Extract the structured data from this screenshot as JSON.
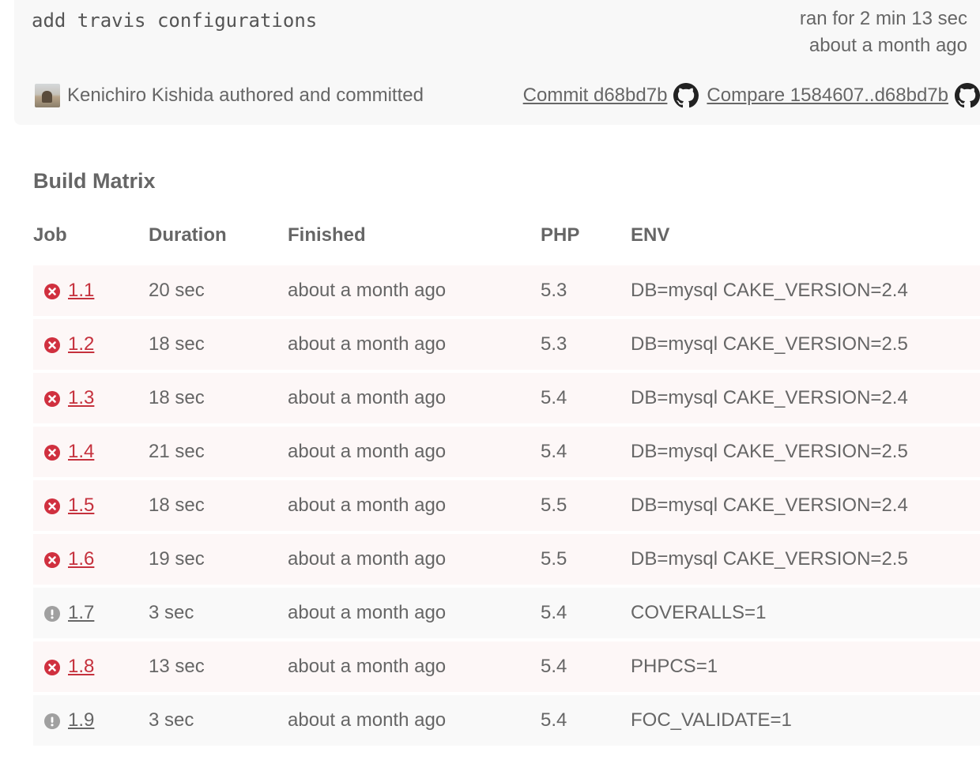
{
  "summary": {
    "commit_message": "add travis configurations",
    "ran_for": "ran for 2 min 13 sec",
    "finished_ago": "about a month ago",
    "author_text": "Kenichiro Kishida authored and committed",
    "commit_link": "Commit d68bd7b",
    "compare_link": "Compare 1584607..d68bd7b",
    "icons": [
      "github-icon",
      "github-icon"
    ]
  },
  "matrix": {
    "title": "Build Matrix",
    "headers": {
      "job": "Job",
      "duration": "Duration",
      "finished": "Finished",
      "php": "PHP",
      "env": "ENV"
    },
    "rows": [
      {
        "status": "failed",
        "number": "1.1",
        "duration": "20 sec",
        "finished": "about a month ago",
        "php": "5.3",
        "env": "DB=mysql CAKE_VERSION=2.4"
      },
      {
        "status": "failed",
        "number": "1.2",
        "duration": "18 sec",
        "finished": "about a month ago",
        "php": "5.3",
        "env": "DB=mysql CAKE_VERSION=2.5"
      },
      {
        "status": "failed",
        "number": "1.3",
        "duration": "18 sec",
        "finished": "about a month ago",
        "php": "5.4",
        "env": "DB=mysql CAKE_VERSION=2.4"
      },
      {
        "status": "failed",
        "number": "1.4",
        "duration": "21 sec",
        "finished": "about a month ago",
        "php": "5.4",
        "env": "DB=mysql CAKE_VERSION=2.5"
      },
      {
        "status": "failed",
        "number": "1.5",
        "duration": "18 sec",
        "finished": "about a month ago",
        "php": "5.5",
        "env": "DB=mysql CAKE_VERSION=2.4"
      },
      {
        "status": "failed",
        "number": "1.6",
        "duration": "19 sec",
        "finished": "about a month ago",
        "php": "5.5",
        "env": "DB=mysql CAKE_VERSION=2.5"
      },
      {
        "status": "errored",
        "number": "1.7",
        "duration": "3 sec",
        "finished": "about a month ago",
        "php": "5.4",
        "env": "COVERALLS=1"
      },
      {
        "status": "failed",
        "number": "1.8",
        "duration": "13 sec",
        "finished": "about a month ago",
        "php": "5.4",
        "env": "PHPCS=1"
      },
      {
        "status": "errored",
        "number": "1.9",
        "duration": "3 sec",
        "finished": "about a month ago",
        "php": "5.4",
        "env": "FOC_VALIDATE=1"
      }
    ]
  },
  "colors": {
    "failed": "#d0303f",
    "errored": "#a0a0a0",
    "text": "#666666",
    "summary_bg": "#f8f8f8",
    "failed_row_bg": "#fdf7f7",
    "errored_row_bg": "#f9f9f9"
  }
}
